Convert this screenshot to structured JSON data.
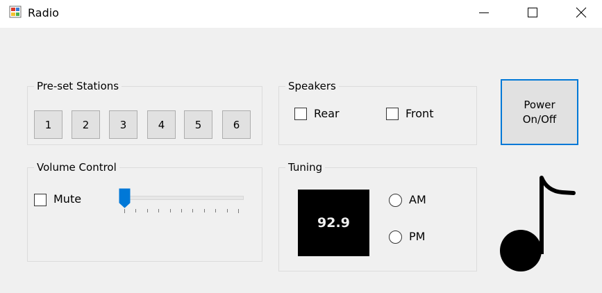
{
  "window": {
    "title": "Radio",
    "icon": "app-icon"
  },
  "presets": {
    "title": "Pre-set Stations",
    "buttons": [
      "1",
      "2",
      "3",
      "4",
      "5",
      "6"
    ]
  },
  "speakers": {
    "title": "Speakers",
    "rear_label": "Rear",
    "rear_checked": false,
    "front_label": "Front",
    "front_checked": false
  },
  "power": {
    "line1": "Power",
    "line2": "On/Off"
  },
  "volume": {
    "title": "Volume Control",
    "mute_label": "Mute",
    "mute_checked": false,
    "slider_value": 0,
    "slider_min": 0,
    "slider_max": 10
  },
  "tuning": {
    "title": "Tuning",
    "frequency": "92.9",
    "am_label": "AM",
    "am_selected": false,
    "pm_label": "PM",
    "pm_selected": false
  },
  "decor": {
    "icon": "music-note-icon"
  },
  "colors": {
    "focus_accent": "#0078d7",
    "display_bg": "#000000"
  }
}
